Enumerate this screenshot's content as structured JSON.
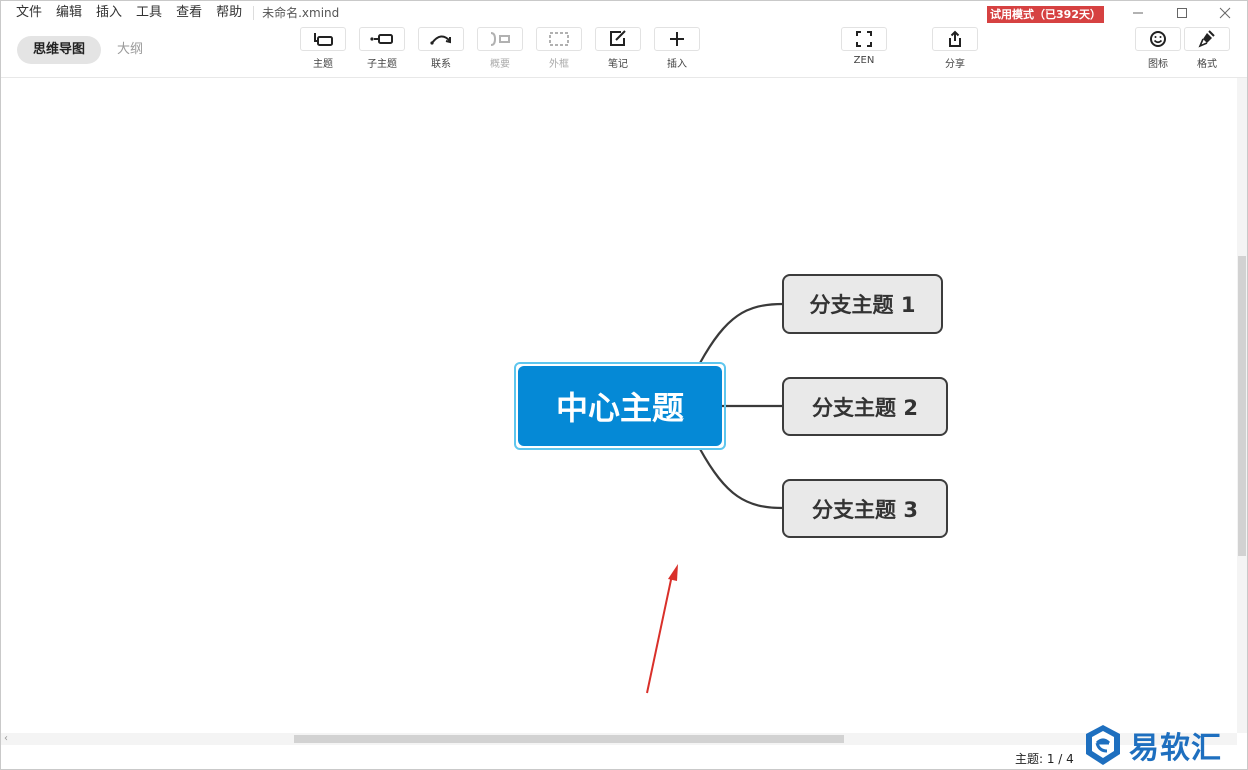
{
  "menu": {
    "items": [
      "文件",
      "编辑",
      "插入",
      "工具",
      "查看",
      "帮助"
    ],
    "doc_title": "未命名.xmind",
    "trial_badge": "试用模式（已392天）"
  },
  "view_tabs": {
    "mindmap": "思维导图",
    "outline": "大纲"
  },
  "toolbar": {
    "topic": "主题",
    "subtopic": "子主题",
    "relationship": "联系",
    "summary": "概要",
    "boundary": "外框",
    "note": "笔记",
    "insert": "插入",
    "zen": "ZEN",
    "share": "分享",
    "icon": "图标",
    "format": "格式"
  },
  "mindmap": {
    "central": "中心主题",
    "branches": [
      "分支主题 1",
      "分支主题 2",
      "分支主题 3"
    ]
  },
  "status": {
    "topic_count": "主题: 1 / 4"
  },
  "watermark": {
    "text": "易软汇"
  },
  "colors": {
    "central_fill": "#0589d6",
    "selection_outline": "#5ec6ee",
    "branch_fill": "#e9e9e9",
    "trial_badge": "#d64141",
    "annotation_arrow": "#d9302a",
    "watermark": "#1e6fbf"
  }
}
